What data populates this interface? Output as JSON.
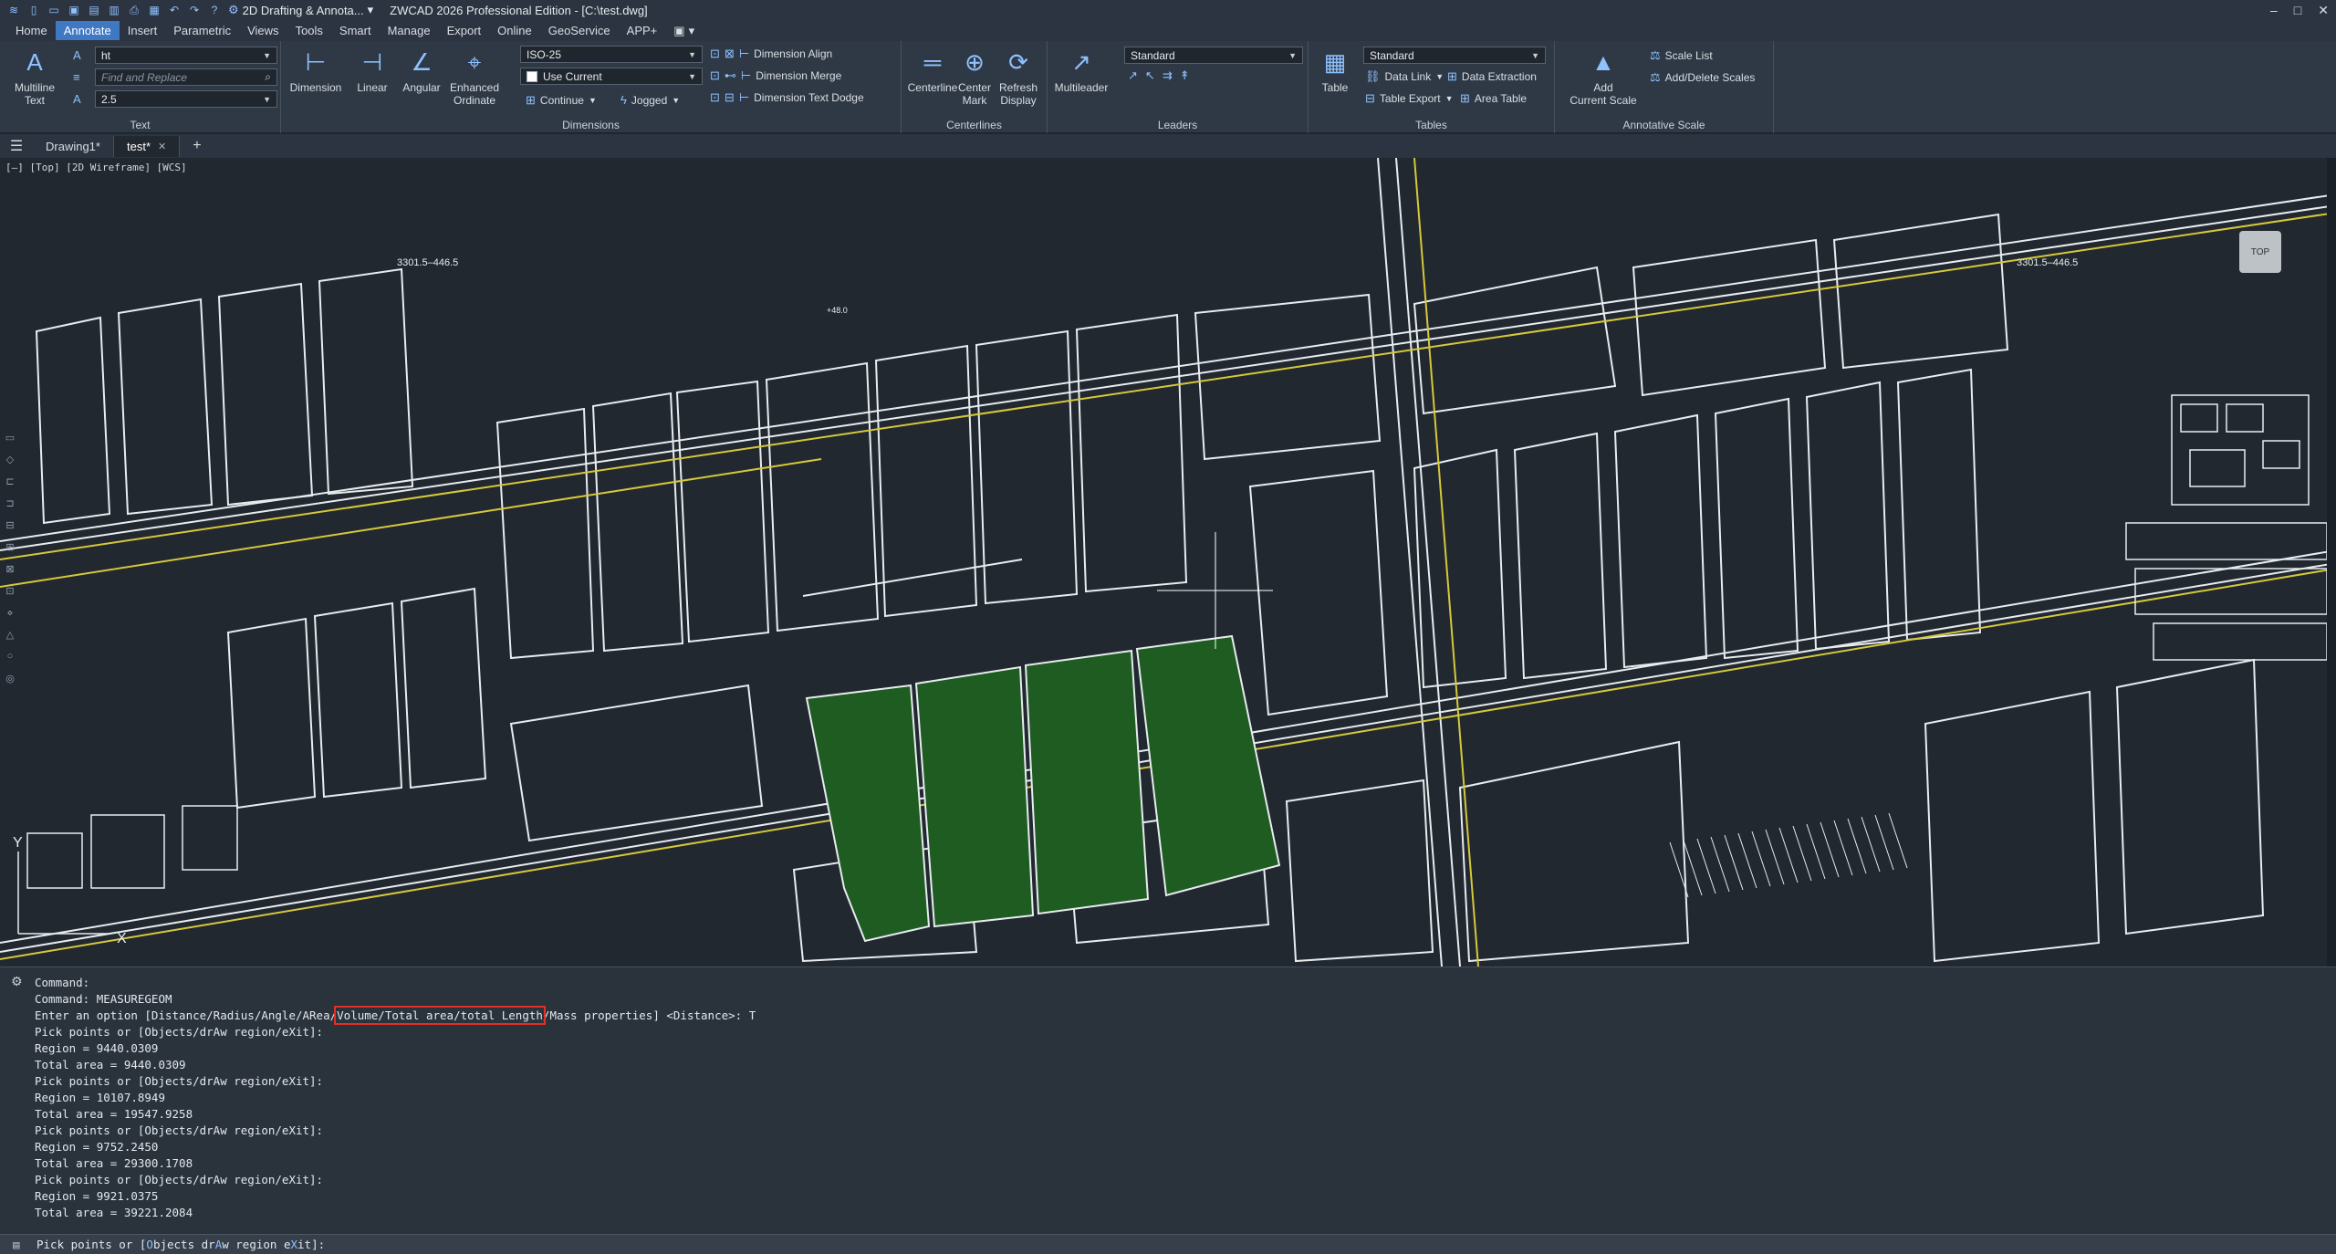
{
  "titlebar": {
    "workspace": "2D Drafting & Annota...",
    "title": "ZWCAD 2026 Professional Edition - [C:\\test.dwg]",
    "minimize": "–",
    "maximize": "□",
    "close": "✕"
  },
  "menu": {
    "items": [
      "Home",
      "Annotate",
      "Insert",
      "Parametric",
      "Views",
      "Tools",
      "Smart",
      "Manage",
      "Export",
      "Online",
      "GeoService",
      "APP+"
    ],
    "active_index": 1
  },
  "ribbon": {
    "text_panel": {
      "title": "Text",
      "multiline_label": "Multiline\nText",
      "style_value": "ht",
      "find_placeholder": "Find and Replace",
      "height_value": "2.5"
    },
    "dimensions_panel": {
      "title": "Dimensions",
      "dimension_label": "Dimension",
      "linear_label": "Linear",
      "angular_label": "Angular",
      "enhanced_label": "Enhanced\nOrdinate",
      "style_value": "ISO-25",
      "use_current_label": "Use Current",
      "continue_label": "Continue",
      "jogged_label": "Jogged",
      "align_label": "Dimension Align",
      "merge_label": "Dimension Merge",
      "dodge_label": "Dimension Text Dodge"
    },
    "centerlines_panel": {
      "title": "Centerlines",
      "centerline_label": "Centerline",
      "centermark_label": "Center\nMark",
      "refresh_label": "Refresh\nDisplay"
    },
    "leaders_panel": {
      "title": "Leaders",
      "multileader_label": "Multileader",
      "style_value": "Standard"
    },
    "tables_panel": {
      "title": "Tables",
      "table_label": "Table",
      "style_value": "Standard",
      "data_link_label": "Data Link",
      "data_extraction_label": "Data Extraction",
      "table_export_label": "Table Export",
      "area_table_label": "Area Table"
    },
    "annoscale_panel": {
      "title": "Annotative Scale",
      "add_current_label": "Add\nCurrent Scale",
      "scale_list_label": "Scale List",
      "add_delete_label": "Add/Delete Scales"
    }
  },
  "tabs": {
    "items": [
      {
        "label": "Drawing1*",
        "active": false
      },
      {
        "label": "test*",
        "active": true
      }
    ],
    "add_label": "+"
  },
  "drawing": {
    "viewport_label": "[–] [Top] [2D Wireframe] [WCS]",
    "viewcube_label": "TOP",
    "annotations": [
      "3301.5–446.5",
      "3301.5–446.5",
      "+48.0"
    ],
    "axis_x": "X",
    "axis_y": "Y",
    "colors": {
      "background": "#212830",
      "lines": "#e8ecef",
      "roads": "#d6c83a",
      "selection": "#1e5c22"
    }
  },
  "command": {
    "lines": [
      "Command:",
      "Command: MEASUREGEOM",
      "Enter an option [Distance/Radius/Angle/ARea/Volume/Total area/total Length/Mass properties] <Distance>: T",
      "Pick points or [Objects/drAw region/eXit]:",
      "Region = 9440.0309",
      "Total area = 9440.0309",
      "Pick points or [Objects/drAw region/eXit]:",
      "Region = 10107.8949",
      "Total area = 19547.9258",
      "Pick points or [Objects/drAw region/eXit]:",
      "Region = 9752.2450",
      "Total area = 29300.1708",
      "Pick points or [Objects/drAw region/eXit]:",
      "Region = 9921.0375",
      "Total area = 39221.2084"
    ],
    "option_before": "Enter an option [Distance/Radius/Angle/ARea/",
    "option_highlight": "Volume/Total area/total Length",
    "option_after": "/Mass properties] <Distance>: T",
    "prompt_start": "Pick points or [",
    "prompt_kw1": "O",
    "prompt_mid1": "bjects dr",
    "prompt_kw2": "A",
    "prompt_mid2": "w region e",
    "prompt_kw3": "X",
    "prompt_end": "it]:"
  }
}
